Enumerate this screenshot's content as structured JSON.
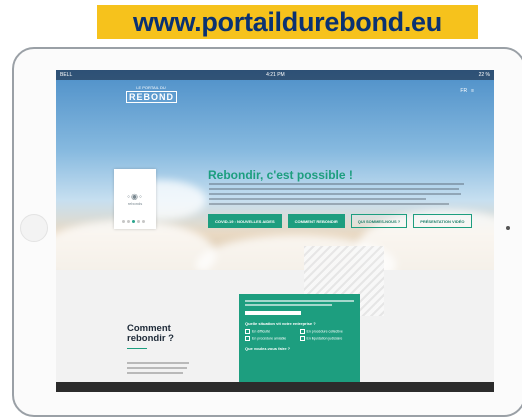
{
  "banner": {
    "url": "www.portaildurebond.eu"
  },
  "status_bar": {
    "carrier": "BELL",
    "time": "4:21 PM",
    "battery": "22 %"
  },
  "site": {
    "logo": {
      "small": "LE PORTAIL DU",
      "word": "REBOND"
    },
    "nav": {
      "lang": "FR",
      "menu": "≡"
    },
    "slider": {
      "card_text": "rebonds",
      "active_dot": 2,
      "dot_count": 5
    },
    "hero": {
      "headline": "Rebondir, c'est possible !",
      "buttons": [
        {
          "label": "COVID-19 : NOUVELLES AIDES",
          "style": "fill"
        },
        {
          "label": "COMMENT REBONDIR",
          "style": "fill"
        },
        {
          "label": "QUI SOMMES-NOUS ?",
          "style": "outline"
        },
        {
          "label": "PRÉSENTATION VIDÉO",
          "style": "outline"
        }
      ]
    },
    "section": {
      "title_line1": "Comment",
      "title_line2": "rebondir ?"
    },
    "panel": {
      "question": "Quelle situation vit votre entreprise ?",
      "options": [
        "En difficulté",
        "En procédure collective",
        "En procédure amiable",
        "En liquidation judiciaire"
      ],
      "question2": "Que voulez-vous faire ?"
    }
  },
  "colors": {
    "accent": "#1d9e7f",
    "banner_bg": "#f6c21c",
    "banner_text": "#0a3172"
  }
}
